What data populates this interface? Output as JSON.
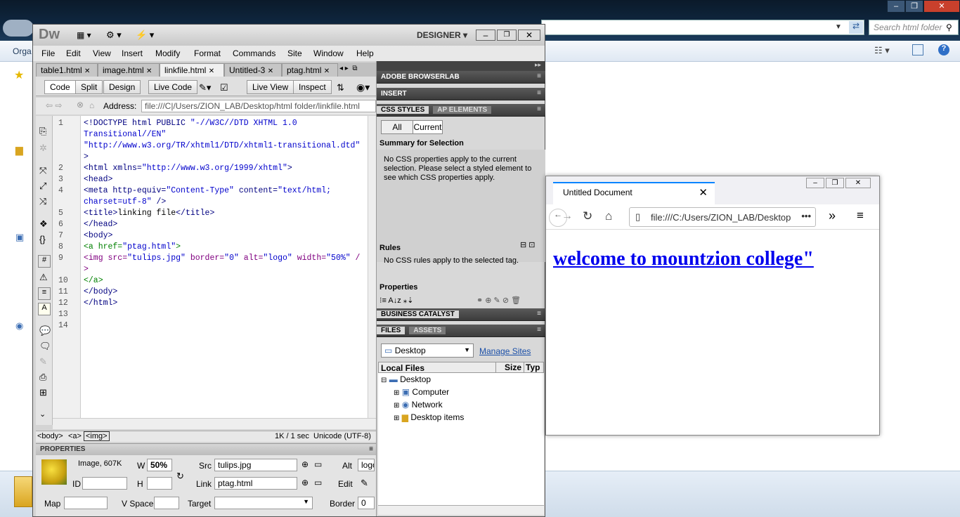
{
  "explorer": {
    "search_placeholder": "Search html folder",
    "cmd_label": "Orga"
  },
  "dreamweaver": {
    "logo": "Dw",
    "workspace": "DESIGNER",
    "menu": [
      "File",
      "Edit",
      "View",
      "Insert",
      "Modify",
      "Format",
      "Commands",
      "Site",
      "Window",
      "Help"
    ],
    "tabs": [
      "table1.html",
      "image.html",
      "linkfile.html",
      "Untitled-3",
      "ptag.html"
    ],
    "active_tab": "linkfile.html",
    "toolbar": {
      "code": "Code",
      "split": "Split",
      "design": "Design",
      "live_code": "Live Code",
      "live_view": "Live View",
      "inspect": "Inspect"
    },
    "address_label": "Address:",
    "address": "file:///C|/Users/ZION_LAB/Desktop/html folder/linkfile.html",
    "line_numbers": [
      "1",
      "2",
      "3",
      "4",
      "5",
      "6",
      "7",
      "8",
      "9",
      "10",
      "11",
      "12",
      "13",
      "14"
    ],
    "status": {
      "tag_path": [
        "<body>",
        "<a>",
        "<img>"
      ],
      "info": "1K / 1 sec  Unicode (UTF-8)"
    },
    "properties": {
      "header": "PROPERTIES",
      "image_label": "Image, 607K",
      "id_label": "ID",
      "w_label": "W",
      "w_value": "50%",
      "h_label": "H",
      "h_value": "",
      "src_label": "Src",
      "src_value": "tulips.jpg",
      "link_label": "Link",
      "link_value": "ptag.html",
      "alt_label": "Alt",
      "alt_value": "logo",
      "edit_label": "Edit",
      "map_label": "Map",
      "vspace_label": "V Space",
      "target_label": "Target",
      "border_label": "Border",
      "border_value": "0"
    }
  },
  "panels": {
    "browserlab": "ADOBE BROWSERLAB",
    "insert": "INSERT",
    "css_tab": "CSS STYLES",
    "ap_tab": "AP ELEMENTS",
    "all_btn": "All",
    "current_btn": "Current",
    "summary_title": "Summary for Selection",
    "summary_text": "No CSS properties apply to the current selection.  Please select a styled element to see which CSS properties apply.",
    "rules_title": "Rules",
    "rules_text": "No CSS rules apply to the selected tag.",
    "properties_title": "Properties",
    "business": "BUSINESS CATALYST",
    "files_tab": "FILES",
    "assets_tab": "ASSETS",
    "site_select": "Desktop",
    "manage_sites": "Manage Sites",
    "col_local": "Local Files",
    "col_size": "Size",
    "col_type": "Typ",
    "tree": {
      "root": "Desktop",
      "children": [
        "Computer",
        "Network",
        "Desktop items"
      ]
    }
  },
  "browser": {
    "tab_title": "Untitled Document",
    "url": "file:///C:/Users/ZION_LAB/Desktop",
    "link_text": "welcome to mountzion college\""
  }
}
